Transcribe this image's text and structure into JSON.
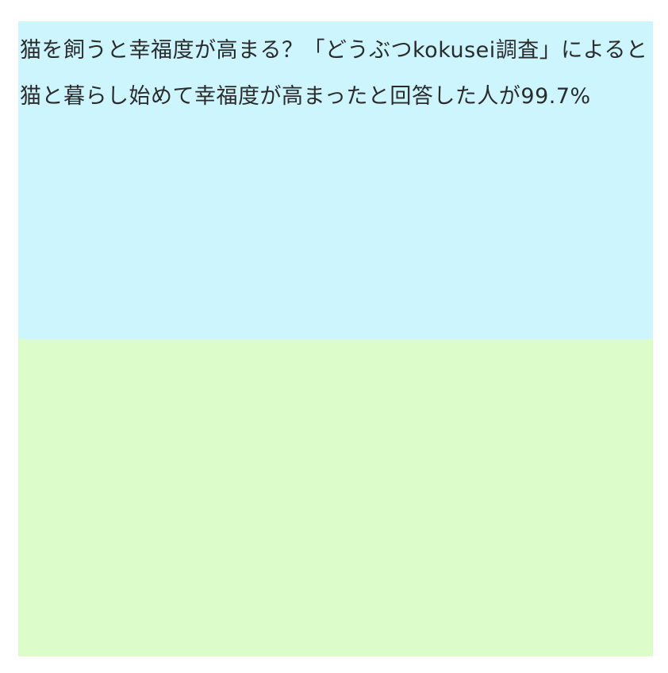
{
  "top_panel": {
    "text": "猫を飼うと幸福度が高まる？「どうぶつkokusei調査」によると 猫と暮らし始めて幸福度が高まったと回答した人が99.7%",
    "background": "#ccf5fe"
  },
  "bottom_panel": {
    "text": "",
    "background": "#dcfcc9"
  }
}
